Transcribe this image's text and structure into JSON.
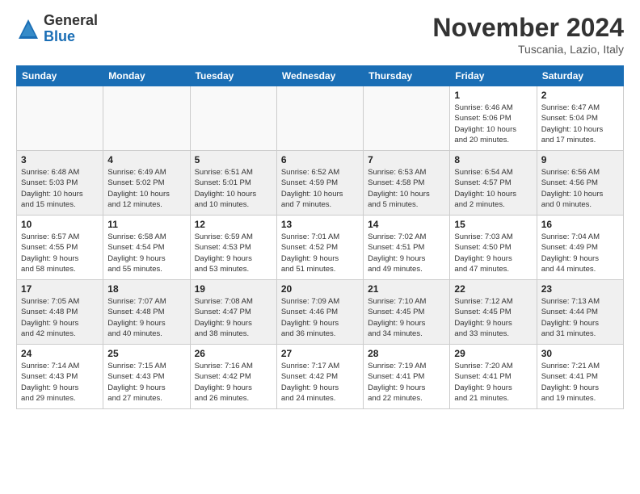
{
  "logo": {
    "general": "General",
    "blue": "Blue"
  },
  "title": "November 2024",
  "subtitle": "Tuscania, Lazio, Italy",
  "days_header": [
    "Sunday",
    "Monday",
    "Tuesday",
    "Wednesday",
    "Thursday",
    "Friday",
    "Saturday"
  ],
  "weeks": [
    [
      {
        "day": "",
        "info": ""
      },
      {
        "day": "",
        "info": ""
      },
      {
        "day": "",
        "info": ""
      },
      {
        "day": "",
        "info": ""
      },
      {
        "day": "",
        "info": ""
      },
      {
        "day": "1",
        "info": "Sunrise: 6:46 AM\nSunset: 5:06 PM\nDaylight: 10 hours\nand 20 minutes."
      },
      {
        "day": "2",
        "info": "Sunrise: 6:47 AM\nSunset: 5:04 PM\nDaylight: 10 hours\nand 17 minutes."
      }
    ],
    [
      {
        "day": "3",
        "info": "Sunrise: 6:48 AM\nSunset: 5:03 PM\nDaylight: 10 hours\nand 15 minutes."
      },
      {
        "day": "4",
        "info": "Sunrise: 6:49 AM\nSunset: 5:02 PM\nDaylight: 10 hours\nand 12 minutes."
      },
      {
        "day": "5",
        "info": "Sunrise: 6:51 AM\nSunset: 5:01 PM\nDaylight: 10 hours\nand 10 minutes."
      },
      {
        "day": "6",
        "info": "Sunrise: 6:52 AM\nSunset: 4:59 PM\nDaylight: 10 hours\nand 7 minutes."
      },
      {
        "day": "7",
        "info": "Sunrise: 6:53 AM\nSunset: 4:58 PM\nDaylight: 10 hours\nand 5 minutes."
      },
      {
        "day": "8",
        "info": "Sunrise: 6:54 AM\nSunset: 4:57 PM\nDaylight: 10 hours\nand 2 minutes."
      },
      {
        "day": "9",
        "info": "Sunrise: 6:56 AM\nSunset: 4:56 PM\nDaylight: 10 hours\nand 0 minutes."
      }
    ],
    [
      {
        "day": "10",
        "info": "Sunrise: 6:57 AM\nSunset: 4:55 PM\nDaylight: 9 hours\nand 58 minutes."
      },
      {
        "day": "11",
        "info": "Sunrise: 6:58 AM\nSunset: 4:54 PM\nDaylight: 9 hours\nand 55 minutes."
      },
      {
        "day": "12",
        "info": "Sunrise: 6:59 AM\nSunset: 4:53 PM\nDaylight: 9 hours\nand 53 minutes."
      },
      {
        "day": "13",
        "info": "Sunrise: 7:01 AM\nSunset: 4:52 PM\nDaylight: 9 hours\nand 51 minutes."
      },
      {
        "day": "14",
        "info": "Sunrise: 7:02 AM\nSunset: 4:51 PM\nDaylight: 9 hours\nand 49 minutes."
      },
      {
        "day": "15",
        "info": "Sunrise: 7:03 AM\nSunset: 4:50 PM\nDaylight: 9 hours\nand 47 minutes."
      },
      {
        "day": "16",
        "info": "Sunrise: 7:04 AM\nSunset: 4:49 PM\nDaylight: 9 hours\nand 44 minutes."
      }
    ],
    [
      {
        "day": "17",
        "info": "Sunrise: 7:05 AM\nSunset: 4:48 PM\nDaylight: 9 hours\nand 42 minutes."
      },
      {
        "day": "18",
        "info": "Sunrise: 7:07 AM\nSunset: 4:48 PM\nDaylight: 9 hours\nand 40 minutes."
      },
      {
        "day": "19",
        "info": "Sunrise: 7:08 AM\nSunset: 4:47 PM\nDaylight: 9 hours\nand 38 minutes."
      },
      {
        "day": "20",
        "info": "Sunrise: 7:09 AM\nSunset: 4:46 PM\nDaylight: 9 hours\nand 36 minutes."
      },
      {
        "day": "21",
        "info": "Sunrise: 7:10 AM\nSunset: 4:45 PM\nDaylight: 9 hours\nand 34 minutes."
      },
      {
        "day": "22",
        "info": "Sunrise: 7:12 AM\nSunset: 4:45 PM\nDaylight: 9 hours\nand 33 minutes."
      },
      {
        "day": "23",
        "info": "Sunrise: 7:13 AM\nSunset: 4:44 PM\nDaylight: 9 hours\nand 31 minutes."
      }
    ],
    [
      {
        "day": "24",
        "info": "Sunrise: 7:14 AM\nSunset: 4:43 PM\nDaylight: 9 hours\nand 29 minutes."
      },
      {
        "day": "25",
        "info": "Sunrise: 7:15 AM\nSunset: 4:43 PM\nDaylight: 9 hours\nand 27 minutes."
      },
      {
        "day": "26",
        "info": "Sunrise: 7:16 AM\nSunset: 4:42 PM\nDaylight: 9 hours\nand 26 minutes."
      },
      {
        "day": "27",
        "info": "Sunrise: 7:17 AM\nSunset: 4:42 PM\nDaylight: 9 hours\nand 24 minutes."
      },
      {
        "day": "28",
        "info": "Sunrise: 7:19 AM\nSunset: 4:41 PM\nDaylight: 9 hours\nand 22 minutes."
      },
      {
        "day": "29",
        "info": "Sunrise: 7:20 AM\nSunset: 4:41 PM\nDaylight: 9 hours\nand 21 minutes."
      },
      {
        "day": "30",
        "info": "Sunrise: 7:21 AM\nSunset: 4:41 PM\nDaylight: 9 hours\nand 19 minutes."
      }
    ]
  ]
}
